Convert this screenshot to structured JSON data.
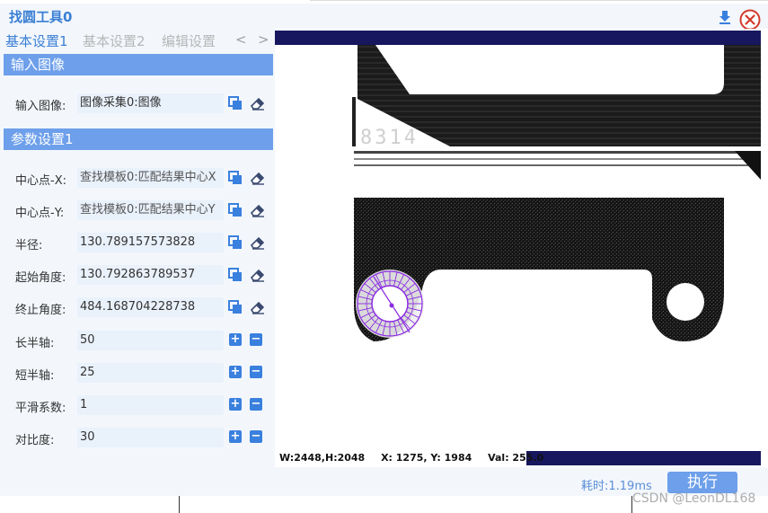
{
  "window": {
    "title": "找圆工具0"
  },
  "tabs": [
    {
      "label": "基本设置1",
      "active": true
    },
    {
      "label": "基本设置2",
      "active": false
    },
    {
      "label": "编辑设置",
      "active": false
    }
  ],
  "tab_nav": {
    "prev": "<",
    "next": ">"
  },
  "sections": {
    "input_image": {
      "header": "输入图像",
      "label": "输入图像:",
      "value": "图像采集0:图像"
    },
    "params": {
      "header": "参数设置1",
      "rows": [
        {
          "label": "中心点-X:",
          "value": "查找模板0:匹配结果中心X"
        },
        {
          "label": "中心点-Y:",
          "value": "查找模板0:匹配结果中心Y"
        },
        {
          "label": "半径:",
          "value": "130.789157573828"
        },
        {
          "label": "起始角度:",
          "value": "130.792863789537"
        },
        {
          "label": "终止角度:",
          "value": "484.168704228738"
        }
      ],
      "stepper_rows": [
        {
          "label": "长半轴:",
          "value": "50"
        },
        {
          "label": "短半轴:",
          "value": "25"
        },
        {
          "label": "平滑系数:",
          "value": "1"
        },
        {
          "label": "对比度:",
          "value": "30"
        }
      ]
    }
  },
  "viewer": {
    "status": {
      "size": "W:2448,H:2048",
      "coords": "X: 1275, Y: 1984",
      "val": "Val: 255.0"
    },
    "part_text": "8314"
  },
  "footer": {
    "time": "耗时:1.19ms",
    "run_label": "执行"
  },
  "watermark": "CSDN @LeonDL168",
  "colors": {
    "accent": "#3b7fd4",
    "section_bg": "#6d9fea",
    "viewer_bar": "#171760",
    "circle_overlay": "#8a2be2"
  },
  "icons": [
    "download-icon",
    "close-icon",
    "link-icon",
    "eraser-icon",
    "plus-icon",
    "minus-icon"
  ]
}
